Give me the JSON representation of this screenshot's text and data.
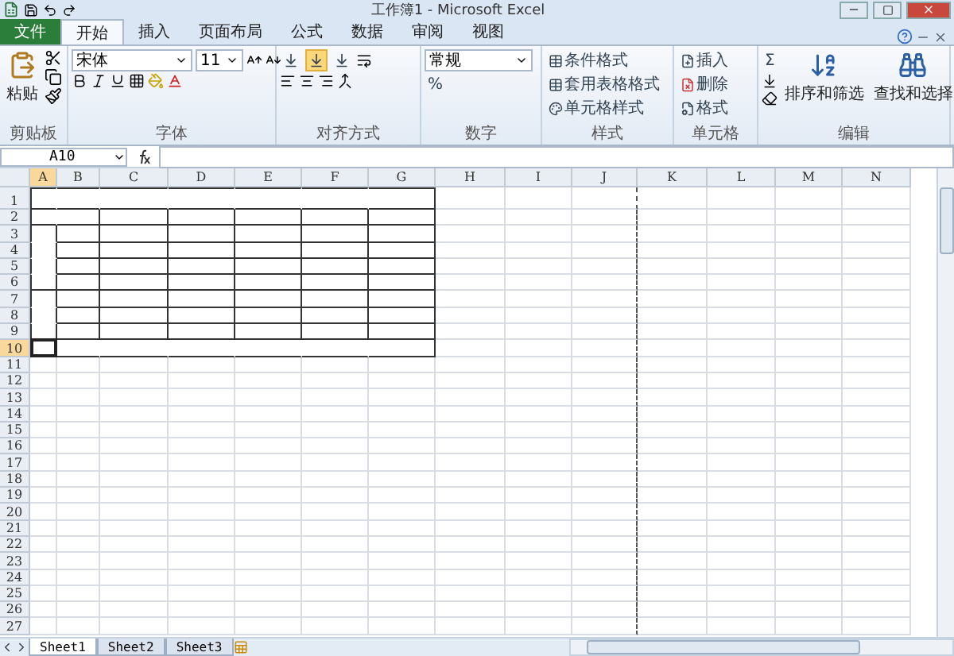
{
  "window": {
    "title": "工作簿1 - Microsoft Excel"
  },
  "ribbon_tabs": [
    {
      "label": "文件",
      "kind": "file",
      "selected": false
    },
    {
      "label": "开始",
      "kind": "tab",
      "selected": true
    },
    {
      "label": "插入",
      "kind": "tab",
      "selected": false
    },
    {
      "label": "页面布局",
      "kind": "tab",
      "selected": false
    },
    {
      "label": "公式",
      "kind": "tab",
      "selected": false
    },
    {
      "label": "数据",
      "kind": "tab",
      "selected": false
    },
    {
      "label": "审阅",
      "kind": "tab",
      "selected": false
    },
    {
      "label": "视图",
      "kind": "tab",
      "selected": false
    }
  ],
  "clipboard": {
    "label": "剪贴板",
    "paste": "粘贴"
  },
  "font": {
    "label": "字体",
    "font_name": "宋体",
    "font_size": "11"
  },
  "alignment": {
    "label": "对齐方式",
    "vertical_align": [
      {
        "selected": false
      },
      {
        "selected": true
      },
      {
        "selected": false
      }
    ]
  },
  "number": {
    "label": "数字",
    "format": "常规",
    "percent": "%"
  },
  "styles": {
    "label": "样式",
    "items": [
      "条件格式",
      "套用表格格式",
      "单元格样式"
    ]
  },
  "cells": {
    "label": "单元格",
    "items": [
      "插入",
      "删除",
      "格式"
    ]
  },
  "editing": {
    "label": "编辑",
    "sigma": "Σ",
    "items": [
      "排序和筛选",
      "查找和选择"
    ]
  },
  "formula_bar": {
    "name_box": "A10"
  },
  "sheet": {
    "columns": [
      {
        "label": "A",
        "selected": true
      },
      {
        "label": "B",
        "selected": false
      },
      {
        "label": "C",
        "selected": false
      },
      {
        "label": "D",
        "selected": false
      },
      {
        "label": "E",
        "selected": false
      },
      {
        "label": "F",
        "selected": false
      },
      {
        "label": "G",
        "selected": false
      },
      {
        "label": "H",
        "selected": false
      },
      {
        "label": "I",
        "selected": false
      },
      {
        "label": "J",
        "selected": false
      },
      {
        "label": "K",
        "selected": false
      },
      {
        "label": "L",
        "selected": false
      },
      {
        "label": "M",
        "selected": false
      },
      {
        "label": "N",
        "selected": false
      }
    ],
    "rows": [
      {
        "label": "1",
        "selected": false
      },
      {
        "label": "2",
        "selected": false
      },
      {
        "label": "3",
        "selected": false
      },
      {
        "label": "4",
        "selected": false
      },
      {
        "label": "5",
        "selected": false
      },
      {
        "label": "6",
        "selected": false
      },
      {
        "label": "7",
        "selected": false
      },
      {
        "label": "8",
        "selected": false
      },
      {
        "label": "9",
        "selected": false
      },
      {
        "label": "10",
        "selected": true
      },
      {
        "label": "11",
        "selected": false
      },
      {
        "label": "12",
        "selected": false
      },
      {
        "label": "13",
        "selected": false
      },
      {
        "label": "14",
        "selected": false
      },
      {
        "label": "15",
        "selected": false
      },
      {
        "label": "16",
        "selected": false
      },
      {
        "label": "17",
        "selected": false
      },
      {
        "label": "18",
        "selected": false
      },
      {
        "label": "19",
        "selected": false
      },
      {
        "label": "20",
        "selected": false
      },
      {
        "label": "21",
        "selected": false
      },
      {
        "label": "22",
        "selected": false
      },
      {
        "label": "23",
        "selected": false
      },
      {
        "label": "24",
        "selected": false
      },
      {
        "label": "25",
        "selected": false
      },
      {
        "label": "26",
        "selected": false
      },
      {
        "label": "27",
        "selected": false
      }
    ]
  },
  "sheet_tabs": [
    {
      "label": "Sheet1",
      "selected": true
    },
    {
      "label": "Sheet2",
      "selected": false
    },
    {
      "label": "Sheet3",
      "selected": false
    }
  ]
}
